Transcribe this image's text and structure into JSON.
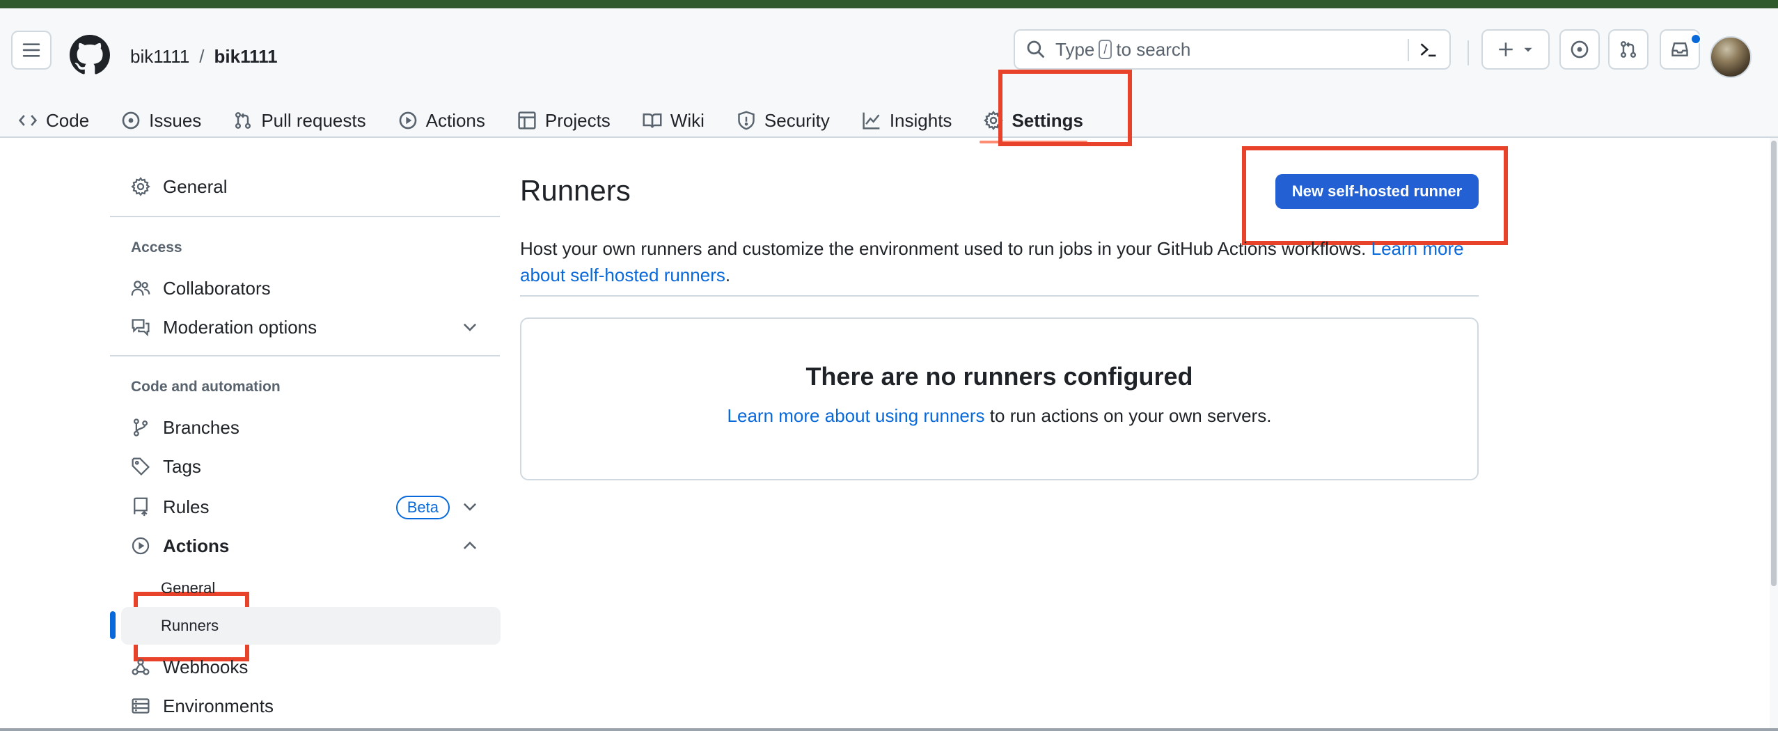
{
  "header": {
    "owner": "bik1111",
    "separator": "/",
    "repo": "bik1111",
    "search": {
      "prefix": "Type",
      "key": "/",
      "suffix": "to search"
    }
  },
  "repo_nav": {
    "items": [
      {
        "label": "Code",
        "icon": "code-icon"
      },
      {
        "label": "Issues",
        "icon": "issue-opened-icon"
      },
      {
        "label": "Pull requests",
        "icon": "git-pull-request-icon"
      },
      {
        "label": "Actions",
        "icon": "play-icon"
      },
      {
        "label": "Projects",
        "icon": "table-icon"
      },
      {
        "label": "Wiki",
        "icon": "book-icon"
      },
      {
        "label": "Security",
        "icon": "shield-icon"
      },
      {
        "label": "Insights",
        "icon": "graph-icon"
      },
      {
        "label": "Settings",
        "icon": "gear-icon",
        "active": true
      }
    ]
  },
  "sidebar": {
    "general": "General",
    "access_heading": "Access",
    "collaborators": "Collaborators",
    "moderation": "Moderation options",
    "code_heading": "Code and automation",
    "branches": "Branches",
    "tags": "Tags",
    "rules": "Rules",
    "rules_badge": "Beta",
    "actions": "Actions",
    "actions_general": "General",
    "actions_runners": "Runners",
    "webhooks": "Webhooks",
    "environments": "Environments"
  },
  "main": {
    "title": "Runners",
    "new_runner_button": "New self-hosted runner",
    "description": "Host your own runners and customize the environment used to run jobs in your GitHub Actions workflows.",
    "description_link": "Learn more about self-hosted runners",
    "description_end": ".",
    "empty_title": "There are no runners configured",
    "empty_link": "Learn more about using runners",
    "empty_text": " to run actions on your own servers."
  },
  "colors": {
    "accent_blue": "#0969da",
    "button_blue": "#2260d4",
    "annotation_red": "#e8432a",
    "active_underline": "#fd8c73"
  }
}
